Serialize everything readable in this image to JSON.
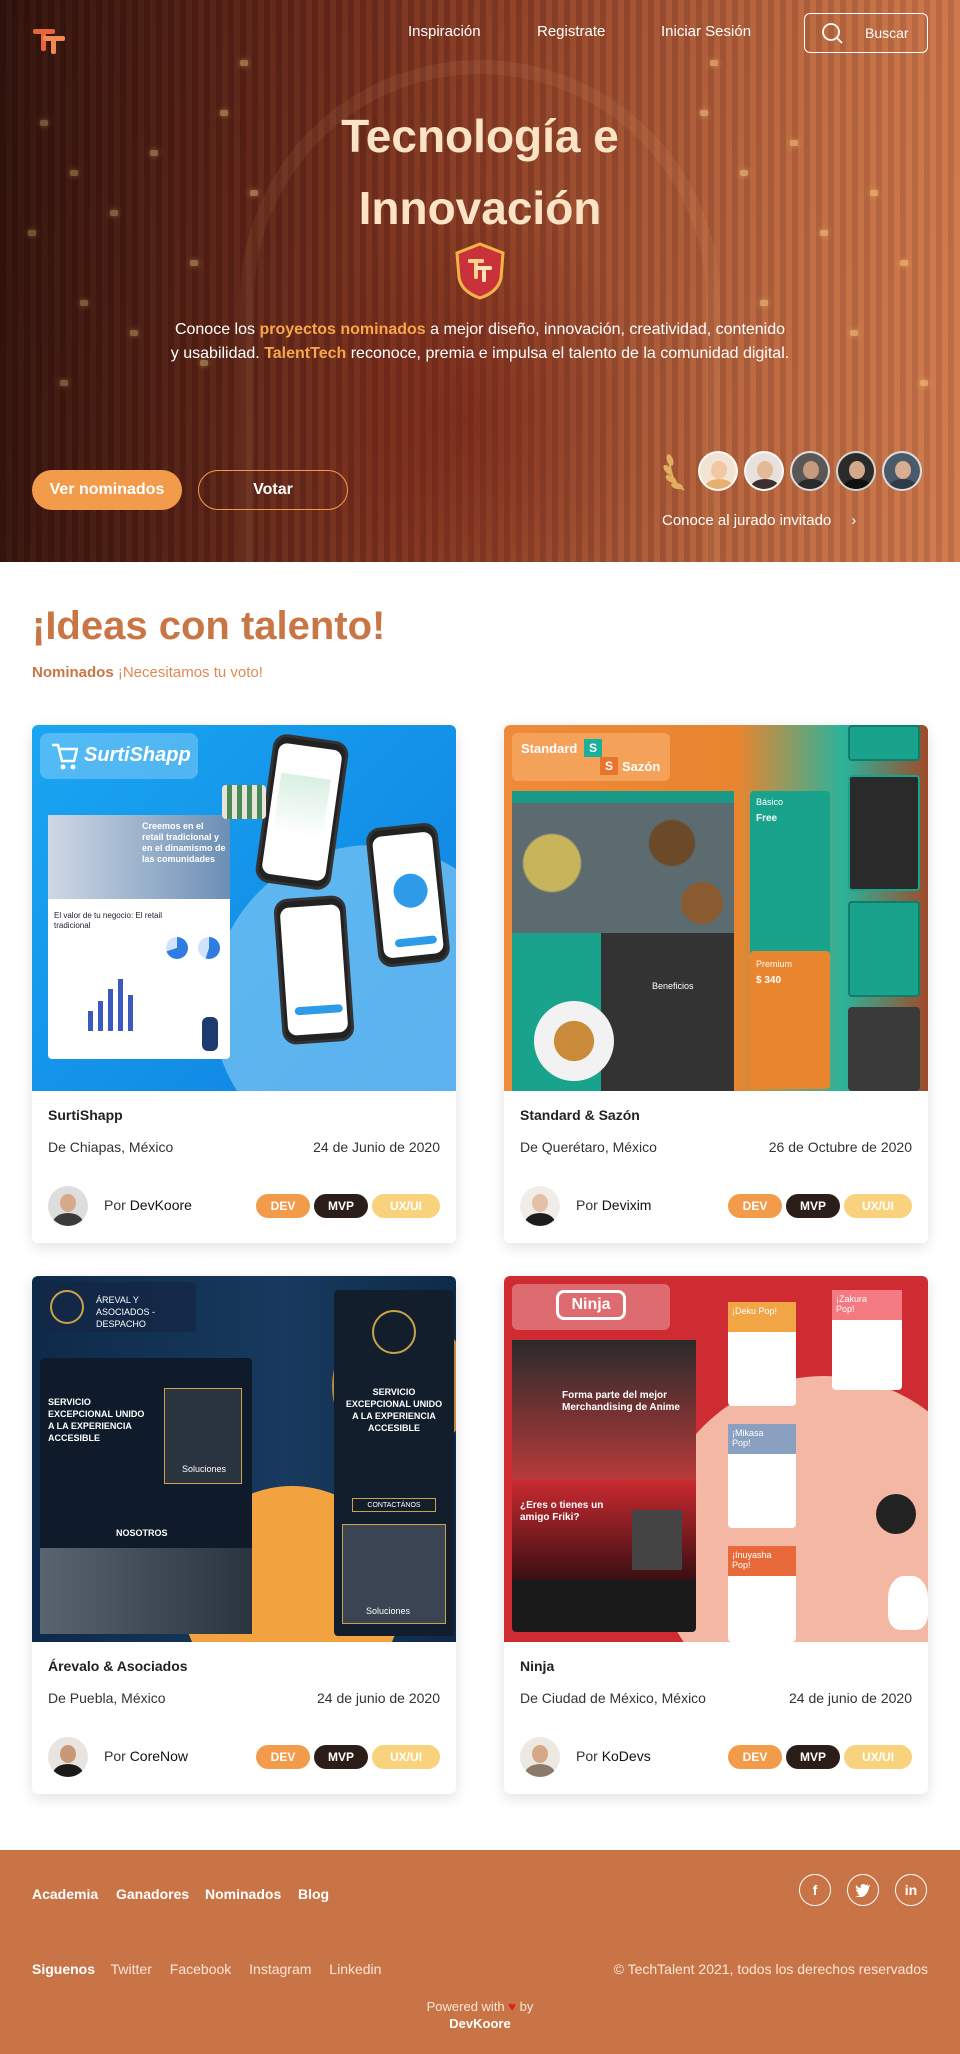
{
  "nav": {
    "links": [
      "Inspiración",
      "Registrate",
      "Iniciar Sesión"
    ],
    "search_label": "Buscar"
  },
  "hero": {
    "title_line1": "Tecnología e",
    "title_line2": "Innovación",
    "desc_pre": "Conoce los ",
    "desc_hl1": "proyectos  nominados",
    "desc_mid": " a mejor diseño, innovación, creatividad, contenido y usabilidad.  ",
    "desc_hl2": "TalentTech",
    "desc_post": " reconoce, premia e impulsa el talento de la comunidad digital.",
    "btn_nominados": "Ver nominados",
    "btn_votar": "Votar",
    "jury_link": "Conoce al jurado invitado"
  },
  "ideas": {
    "title": "¡Ideas con talento!",
    "sub_bold": "Nominados",
    "sub_rest": " ¡Necesitamos tu voto!"
  },
  "tags": {
    "dev": "DEV",
    "mvp": "MVP",
    "ux": "UX/UI"
  },
  "by_label": "Por",
  "cards": [
    {
      "title": "SurtiShapp",
      "location": "De Chiapas, México",
      "date": "24 de Junio de 2020",
      "author": "DevKoore",
      "img_brand": "SurtiShapp",
      "img_headline": "Creemos en el retail tradicional y en el dinamismo de las comunidades",
      "img_text": "El valor de tu negocio: El retail tradicional"
    },
    {
      "title": "Standard & Sazón",
      "location": "De Querétaro, México",
      "date": "26 de Octubre de 2020",
      "author": "Devixim",
      "img_brand_a": "Standard",
      "img_brand_b": "Sazón",
      "img_s": "S",
      "img_benefits": "Beneficios",
      "img_plan1": "Básico",
      "img_plan1_price": "Free",
      "img_plan2": "Premium",
      "img_plan2_price": "$ 340"
    },
    {
      "title": "Árevalo & Asociados",
      "location": "De Puebla, México",
      "date": "24 de junio de 2020",
      "author": "CoreNow",
      "img_brand": "ÁREVAL Y ASOCIADOS - DESPACHO",
      "img_headline": "SERVICIO EXCEPCIONAL UNIDO A LA EXPERIENCIA ACCESIBLE",
      "img_solutions": "Soluciones",
      "img_nosotros": "NOSOTROS",
      "img_cta": "CONTACTÁNOS"
    },
    {
      "title": "Ninja",
      "location": "De Ciudad de México, México",
      "date": "24 de junio de 2020",
      "author": "KoDevs",
      "img_brand": "Ninja",
      "img_headline": "Forma parte del mejor Merchandising de Anime",
      "img_q": "¿Eres o tienes un amigo Friki?",
      "img_pops": [
        "¡Deku Pop!",
        "¡Zakura Pop!",
        "¡Mikasa Pop!",
        "¡Inuyasha Pop!"
      ]
    }
  ],
  "footer": {
    "links": [
      "Academia",
      "Ganadores",
      "Nominados",
      "Blog"
    ],
    "social_icons": [
      "facebook-icon",
      "twitter-icon",
      "linkedin-icon"
    ],
    "follow_label": "Siguenos",
    "follow_links": [
      "Twitter",
      "Facebook",
      "Instagram",
      "Linkedin"
    ],
    "copyright": "© TechTalent 2021, todos los derechos reservados",
    "powered_pre": "Powered with",
    "powered_by": "by",
    "powered_name": "DevKoore"
  },
  "colors": {
    "accent": "#f29b4a",
    "brand": "#c97446",
    "dark": "#2b1d18",
    "ux": "#f8d27c"
  }
}
